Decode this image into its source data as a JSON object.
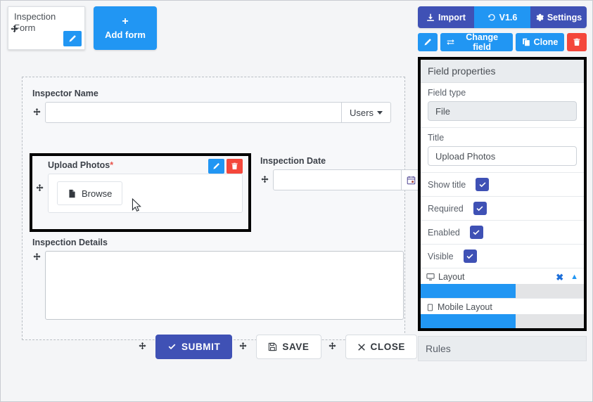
{
  "form_tabs": {
    "card_title": "Inspection Form",
    "drag_icon": "move-icon",
    "edit_icon": "pencil-icon",
    "add_form_label": "Add form",
    "add_form_plus": "+"
  },
  "form": {
    "fields": [
      {
        "id": "inspector-name",
        "label": "Inspector Name",
        "required": false,
        "value": "",
        "control": "text-with-dropdown",
        "dropdown_label": "Users"
      },
      {
        "id": "upload-photos",
        "label": "Upload Photos",
        "required": true,
        "required_mark": "*",
        "control": "file",
        "browse_label": "Browse",
        "selected": true,
        "edit_icon": "pencil-icon",
        "delete_icon": "trash-icon"
      },
      {
        "id": "inspection-date",
        "label": "Inspection Date",
        "required": false,
        "value": "",
        "control": "date",
        "calendar_icon": "calendar-icon"
      },
      {
        "id": "inspection-details",
        "label": "Inspection Details",
        "required": false,
        "value": "",
        "control": "textarea"
      }
    ],
    "actions": [
      {
        "id": "submit",
        "label": "SUBMIT",
        "icon": "check-icon",
        "style": "primary"
      },
      {
        "id": "save",
        "label": "SAVE",
        "icon": "floppy-disk-icon",
        "style": "light"
      },
      {
        "id": "close",
        "label": "CLOSE",
        "icon": "x-icon",
        "style": "light"
      }
    ]
  },
  "toolbar_top": [
    {
      "id": "import",
      "label": "Import",
      "icon": "download-icon",
      "color": "#3f51b5"
    },
    {
      "id": "version",
      "label": "V1.6",
      "icon": "history-icon",
      "color": "#2196f3"
    },
    {
      "id": "settings",
      "label": "Settings",
      "icon": "gear-icon",
      "color": "#3f51b5"
    }
  ],
  "toolbar_field": [
    {
      "id": "edit",
      "label": "",
      "icon": "pencil-icon",
      "color": "#2196f3"
    },
    {
      "id": "change-field",
      "label": "Change field",
      "icon": "exchange-icon",
      "color": "#2196f3"
    },
    {
      "id": "clone",
      "label": "Clone",
      "icon": "copy-icon",
      "color": "#2196f3"
    },
    {
      "id": "delete",
      "label": "",
      "icon": "trash-icon",
      "color": "#f4473b"
    }
  ],
  "properties": {
    "title": "Field properties",
    "field_type": {
      "label": "Field type",
      "value": "File"
    },
    "field_title": {
      "label": "Title",
      "value": "Upload Photos"
    },
    "checkboxes": [
      {
        "id": "show-title",
        "label": "Show title",
        "checked": true
      },
      {
        "id": "required",
        "label": "Required",
        "checked": true
      },
      {
        "id": "enabled",
        "label": "Enabled",
        "checked": true
      },
      {
        "id": "visible",
        "label": "Visible",
        "checked": true
      }
    ],
    "layout": {
      "label": "Layout",
      "icon": "desktop-icon",
      "close_icon": "x-icon",
      "collapse_icon": "chevron-up-icon",
      "fill_percent": 58
    },
    "mobile_layout": {
      "label": "Mobile Layout",
      "icon": "mobile-icon",
      "fill_percent": 58
    }
  },
  "rules": {
    "title": "Rules"
  },
  "colors": {
    "primary_indigo": "#3f51b5",
    "primary_blue": "#2196f3",
    "danger_red": "#f4473b",
    "required_star": "#e8544b",
    "selection_border": "#000000",
    "canvas_bg": "#f4f5f7"
  }
}
